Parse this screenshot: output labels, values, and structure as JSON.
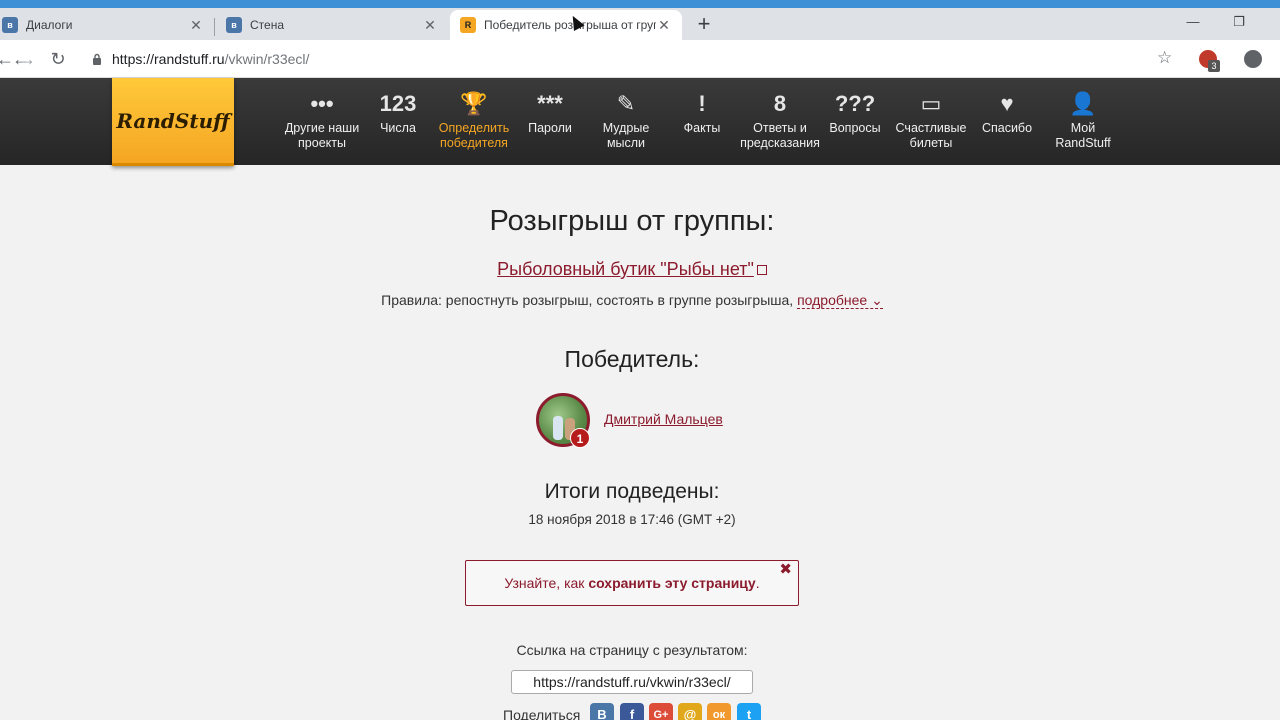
{
  "browser": {
    "tabs": [
      {
        "title": "Диалоги",
        "close": "✕"
      },
      {
        "title": "Стена",
        "close": "✕"
      },
      {
        "title": "Победитель розыгрыша от груп",
        "close": "✕"
      }
    ],
    "new_tab": "+",
    "url_host": "https://randstuff.ru",
    "url_path": "/vkwin/r33ecl/",
    "ext_badge": "3",
    "icons": {
      "back": "arrow-left-icon",
      "forward": "arrow-right-icon",
      "reload": "reload-icon",
      "star": "star-icon",
      "lock": "lock-icon",
      "profile": "profile-icon"
    }
  },
  "site": {
    "logo": "RandStuff",
    "nav": [
      {
        "icon_text": "•••",
        "label": "Другие наши проекты"
      },
      {
        "icon_text": "123",
        "label": "Числа"
      },
      {
        "icon_text": "🏆",
        "label": "Определить победителя"
      },
      {
        "icon_text": "***",
        "label": "Пароли"
      },
      {
        "icon_text": "✎",
        "label": "Мудрые мысли"
      },
      {
        "icon_text": "!",
        "label": "Факты"
      },
      {
        "icon_text": "8",
        "label": "Ответы и предсказания"
      },
      {
        "icon_text": "???",
        "label": "Вопросы"
      },
      {
        "icon_text": "▭",
        "label": "Счастливые билеты"
      },
      {
        "icon_text": "♥",
        "label": "Спасибо"
      },
      {
        "icon_text": "👤",
        "label": "Мой RandStuff"
      }
    ],
    "colors": {
      "accent": "#f5a623",
      "brand_dark": "#8b1b2d",
      "header_bg": "#2e2e2e"
    }
  },
  "main": {
    "title": "Розыгрыш от группы:",
    "group_link": "Рыболовный бутик \"Рыбы нет\"",
    "rules_prefix": "Правила: репостнуть розыгрыш, состоять в группе розыгрыша,",
    "rules_more": "подробнее ⌄",
    "winner_heading": "Победитель:",
    "winner_rank": "1",
    "winner_name": "Дмитрий Мальцев",
    "results_heading": "Итоги подведены:",
    "results_date": "18 ноября 2018 в 17:46 (GMT +2)",
    "notice_prefix": "Узнайте, как ",
    "notice_bold": "сохранить эту страницу",
    "notice_suffix": ".",
    "notice_close": "✖",
    "link_label": "Ссылка на страницу с результатом:",
    "result_url": "https://randstuff.ru/vkwin/r33ecl/",
    "share_label": "Поделиться",
    "share_buttons": [
      "В",
      "f",
      "G+",
      "@",
      "ок",
      "t"
    ]
  }
}
